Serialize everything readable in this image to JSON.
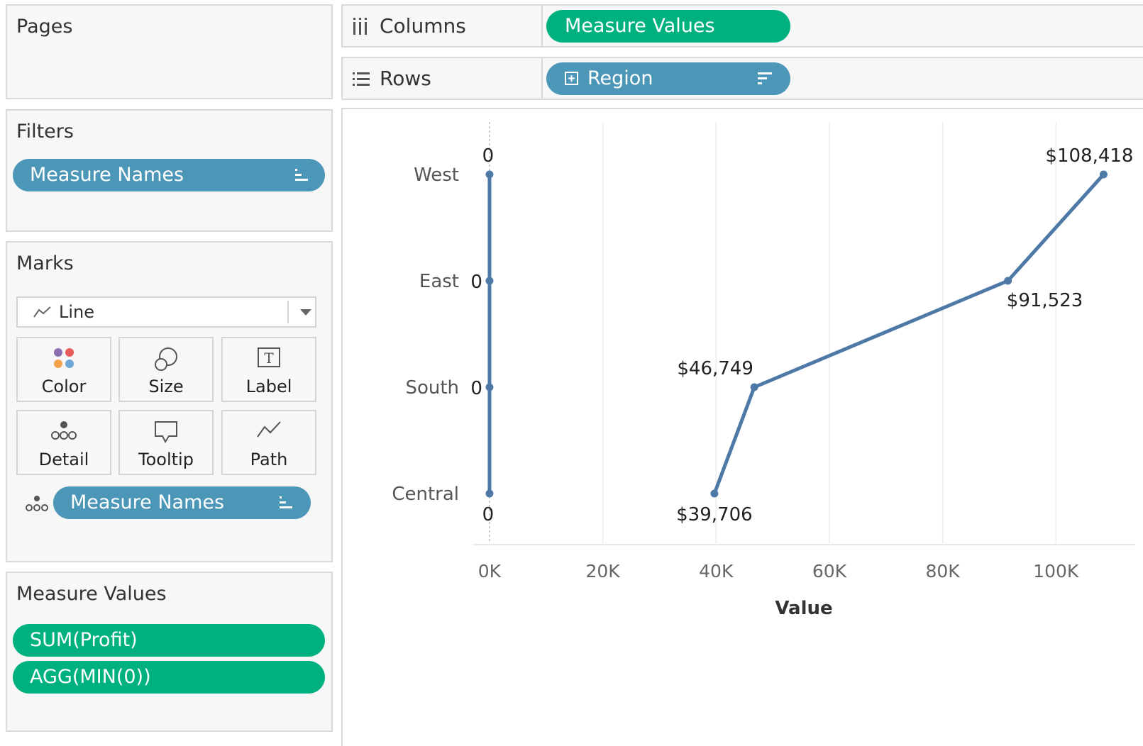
{
  "pages_panel": {
    "title": "Pages"
  },
  "filters_panel": {
    "title": "Filters",
    "pill": "Measure Names"
  },
  "marks_panel": {
    "title": "Marks",
    "mark_type": "Line",
    "cards": [
      "Color",
      "Size",
      "Label",
      "Detail",
      "Tooltip",
      "Path"
    ],
    "detail_pill": "Measure Names"
  },
  "measure_values_panel": {
    "title": "Measure Values",
    "pills": [
      "SUM(Profit)",
      "AGG(MIN(0))"
    ]
  },
  "columns_shelf": {
    "label": "Columns",
    "pill": "Measure Values"
  },
  "rows_shelf": {
    "label": "Rows",
    "pill": "Region"
  },
  "colors": {
    "green_pill": "#00b180",
    "blue_pill": "#4c96b8",
    "line": "#4e79a7"
  },
  "chart_data": {
    "type": "line",
    "xlabel": "Value",
    "xlim": [
      -3000,
      114000
    ],
    "x_ticks": [
      0,
      20000,
      40000,
      60000,
      80000,
      100000
    ],
    "x_tick_labels": [
      "0K",
      "20K",
      "40K",
      "60K",
      "80K",
      "100K"
    ],
    "categories": [
      "West",
      "East",
      "South",
      "Central"
    ],
    "series": [
      {
        "values": [
          108418,
          91523,
          46749,
          39706
        ],
        "labels": [
          "$108,418",
          "$91,523",
          "$46,749",
          "$39,706"
        ]
      },
      {
        "values": [
          0,
          0,
          0,
          0
        ],
        "labels": [
          "0",
          "0",
          "0",
          "0"
        ]
      }
    ]
  }
}
